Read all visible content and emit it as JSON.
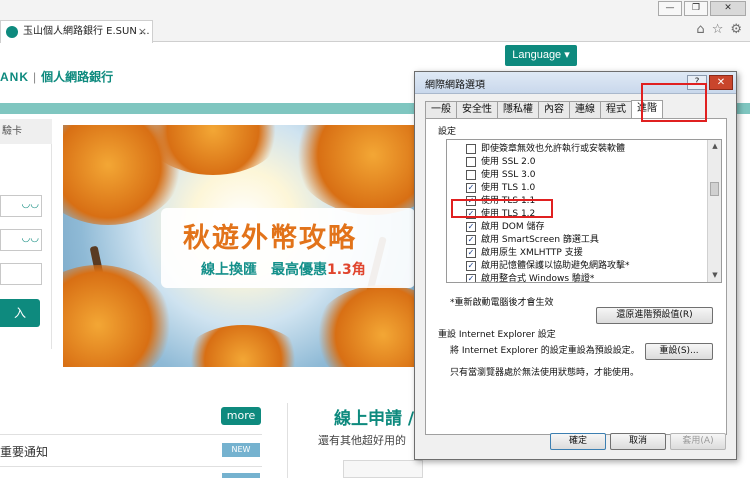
{
  "browser": {
    "tab_title": "玉山個人網路銀行 E.SUN ...",
    "tab_close": "×",
    "window_buttons": [
      "—",
      "❐",
      "✕"
    ],
    "toolbar_icons": [
      "home-icon",
      "favorites-star-icon",
      "settings-gear-icon"
    ]
  },
  "page": {
    "brand": "ANK",
    "brand_sep": "|",
    "brand_sub": "個人網路銀行",
    "language_button": "Language ▾",
    "left_tab_label": "驗卡",
    "login_button": "入",
    "banner": {
      "title": "秋遊外幣攻略",
      "subtitle_prefix": "線上換匯　最高優惠",
      "subtitle_highlight": "1.3角"
    },
    "more_button": "more",
    "notice_item": "重要通知",
    "new_badge": "NEW",
    "apply_title": "線上申請 /",
    "apply_subtitle": "還有其他超好用的"
  },
  "dialog": {
    "title": "網際網路選項",
    "help_button": "?",
    "close_button": "✕",
    "tabs": [
      "一般",
      "安全性",
      "隱私權",
      "內容",
      "連線",
      "程式",
      "進階"
    ],
    "active_tab": "進階",
    "settings_label": "設定",
    "settings": [
      {
        "label": "即使簽章無效也允許執行或安裝軟體",
        "checked": false
      },
      {
        "label": "使用 SSL 2.0",
        "checked": false
      },
      {
        "label": "使用 SSL 3.0",
        "checked": false
      },
      {
        "label": "使用 TLS 1.0",
        "checked": true
      },
      {
        "label": "使用 TLS 1.1",
        "checked": true
      },
      {
        "label": "使用 TLS 1.2",
        "checked": true
      },
      {
        "label": "啟用 DOM 儲存",
        "checked": true
      },
      {
        "label": "啟用 SmartScreen 篩選工具",
        "checked": true
      },
      {
        "label": "啟用原生 XMLHTTP 支援",
        "checked": true
      },
      {
        "label": "啟用記憶體保護以協助避免網路攻擊*",
        "checked": true
      },
      {
        "label": "啟用整合式 Windows 驗證*",
        "checked": true
      }
    ],
    "restart_note": "*重新啟動電腦後才會生效",
    "restore_advanced_button": "還原進階預設值(R)",
    "reset_group_label": "重設 Internet Explorer 設定",
    "reset_description": "將 Internet Explorer 的設定重設為預設設定。",
    "reset_button": "重設(S)...",
    "reset_note": "只有當瀏覽器處於無法使用狀態時，才能使用。",
    "ok_button": "確定",
    "cancel_button": "取消",
    "apply_button": "套用(A)"
  },
  "colors": {
    "brand_teal": "#0e8a7e",
    "highlight_red": "#e02020",
    "banner_orange": "#e2731a"
  }
}
